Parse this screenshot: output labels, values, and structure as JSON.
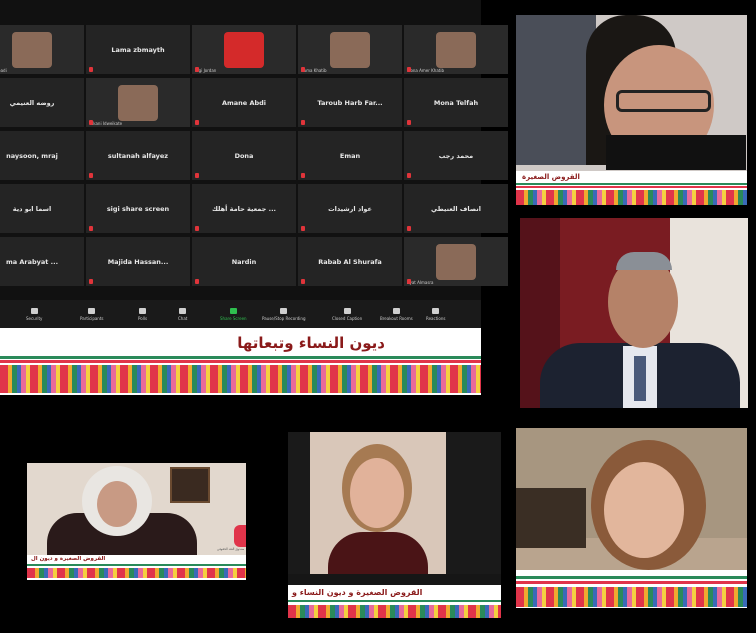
{
  "zoom_window": {
    "grid": [
      {
        "name": "Lama zbadi",
        "type": "thumb",
        "label": "Lama Zbadi"
      },
      {
        "name": "Lama zbmayth",
        "type": "text"
      },
      {
        "name": "logo-tile",
        "type": "thumb",
        "label": "Sigi Jordan"
      },
      {
        "name": "Souma",
        "type": "thumb",
        "label": "Suma Khatib"
      },
      {
        "name": "Mona",
        "type": "thumb",
        "label": "Mona Amer Khatib"
      },
      {
        "name": "روضه العنيمي",
        "type": "text"
      },
      {
        "name": "Takani",
        "type": "thumb",
        "label": "Takani Idweikate"
      },
      {
        "name": "Amane Abdi",
        "type": "text"
      },
      {
        "name": "Taroub Harb Far...",
        "type": "text"
      },
      {
        "name": "Mona Telfah",
        "type": "text"
      },
      {
        "name": "naysoon, mraj",
        "type": "text"
      },
      {
        "name": "sultanah alfayez",
        "type": "text"
      },
      {
        "name": "Dona",
        "type": "text"
      },
      {
        "name": "Eman",
        "type": "text"
      },
      {
        "name": "محمد رجب",
        "type": "text"
      },
      {
        "name": "اسما ابو دية",
        "type": "text"
      },
      {
        "name": "sigi share screen",
        "type": "text"
      },
      {
        "name": "جمعية حامة أهلك ...",
        "type": "text"
      },
      {
        "name": "عواد ارشيدات",
        "type": "text"
      },
      {
        "name": "انصاف العنيطي",
        "type": "text"
      },
      {
        "name": "ma Arabyat ...",
        "type": "text"
      },
      {
        "name": "Majida Hassan...",
        "type": "text"
      },
      {
        "name": "Nardin",
        "type": "text"
      },
      {
        "name": "Rabab Al Shurafa",
        "type": "text"
      },
      {
        "name": "Ayat",
        "type": "thumb",
        "label": "Ayat Almasra"
      }
    ],
    "toolbar": [
      "Security",
      "Participants",
      "Polls",
      "Chat",
      "Share Screen",
      "Pause/Stop Recording",
      "Closed Caption",
      "Breakout Rooms",
      "Reactions"
    ],
    "banner_text": "ديون النساء وتبعاتها"
  },
  "tiles": {
    "top_right_banner": "القروض الصغيرة",
    "bottom_left_banner": "القروض الصغيرة و ديون ال",
    "bottom_left_logo": "صندوق النقد الحقوقي",
    "bottom_mid_banner": "القروض الصغيرة و ديون النساء و"
  },
  "colors": {
    "background": "#000000",
    "banner_text": "#8a1a1a",
    "share_green": "#2fbf4f",
    "mic_off_red": "#e0343a"
  }
}
